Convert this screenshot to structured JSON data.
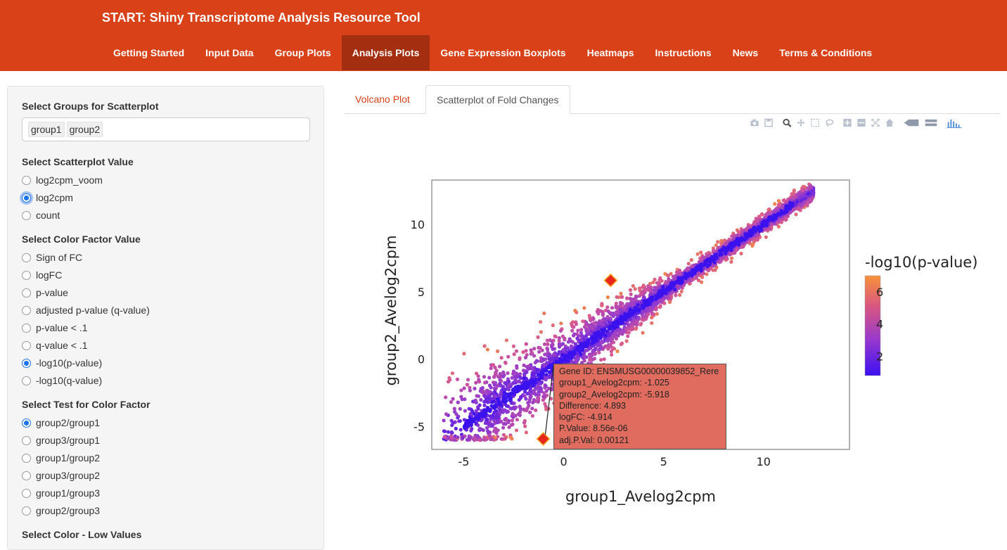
{
  "app": {
    "title": "START: Shiny Transcriptome Analysis Resource Tool"
  },
  "nav": [
    "Getting Started",
    "Input Data",
    "Group Plots",
    "Analysis Plots",
    "Gene Expression Boxplots",
    "Heatmaps",
    "Instructions",
    "News",
    "Terms & Conditions"
  ],
  "nav_active": "Analysis Plots",
  "sidebar": {
    "groups_label": "Select Groups for Scatterplot",
    "groups_selected": [
      "group1",
      "group2"
    ],
    "value_label": "Select Scatterplot Value",
    "value_options": [
      "log2cpm_voom",
      "log2cpm",
      "count"
    ],
    "value_selected": "log2cpm",
    "color_label": "Select Color Factor Value",
    "color_options": [
      "Sign of FC",
      "logFC",
      "p-value",
      "adjusted p-value (q-value)",
      "p-value < .1",
      "q-value < .1",
      "-log10(p-value)",
      "-log10(q-value)"
    ],
    "color_selected": "-log10(p-value)",
    "test_label": "Select Test for Color Factor",
    "test_options": [
      "group2/group1",
      "group3/group1",
      "group1/group2",
      "group3/group2",
      "group1/group3",
      "group2/group3"
    ],
    "test_selected": "group2/group1",
    "low_color_label": "Select Color - Low Values"
  },
  "tabs": [
    "Volcano Plot",
    "Scatterplot of Fold Changes"
  ],
  "tab_active": "Scatterplot of Fold Changes",
  "modebar_icons": [
    "camera-icon",
    "save-icon",
    "zoom-icon",
    "pan-icon",
    "box-select-icon",
    "lasso-icon",
    "zoom-in-icon",
    "zoom-out-icon",
    "autoscale-icon",
    "reset-axes-icon",
    "spike-lines-icon",
    "compare-hover-icon",
    "plotly-logo-icon"
  ],
  "chart_data": {
    "type": "scatter",
    "xlabel": "group1_Avelog2cpm",
    "ylabel": "group2_Avelog2cpm",
    "xlim": [
      -6.6,
      14.3
    ],
    "ylim": [
      -6.7,
      13.3
    ],
    "xticks": [
      -5,
      0,
      5,
      10
    ],
    "yticks": [
      -5,
      0,
      5,
      10
    ],
    "colorbar": {
      "title": "-log10(p-value)",
      "ticks": [
        2,
        4,
        6
      ],
      "range": [
        0.8,
        7.0
      ],
      "low_color": "#3b0ff0",
      "high_color": "#f7923a"
    },
    "trend": {
      "description": "dense cloud of genes along the diagonal from about (-6,-6) to (12.5,12.5), colored mostly blue-purple with magenta/orange outliers"
    },
    "highlighted": [
      {
        "x": -1.025,
        "y": -5.918,
        "color": "#e8261c"
      },
      {
        "x": 2.35,
        "y": 5.85,
        "color": "#e8261c"
      }
    ],
    "tooltip": {
      "lines": [
        "Gene ID: ENSMUSG00000039852_Rere",
        "group1_Avelog2cpm: -1.025",
        "group2_Avelog2cpm: -5.918",
        "Difference: 4.893",
        "logFC: -4.914",
        "P.Value: 8.56e-06",
        "adj.P.Val: 0.00121"
      ]
    }
  }
}
